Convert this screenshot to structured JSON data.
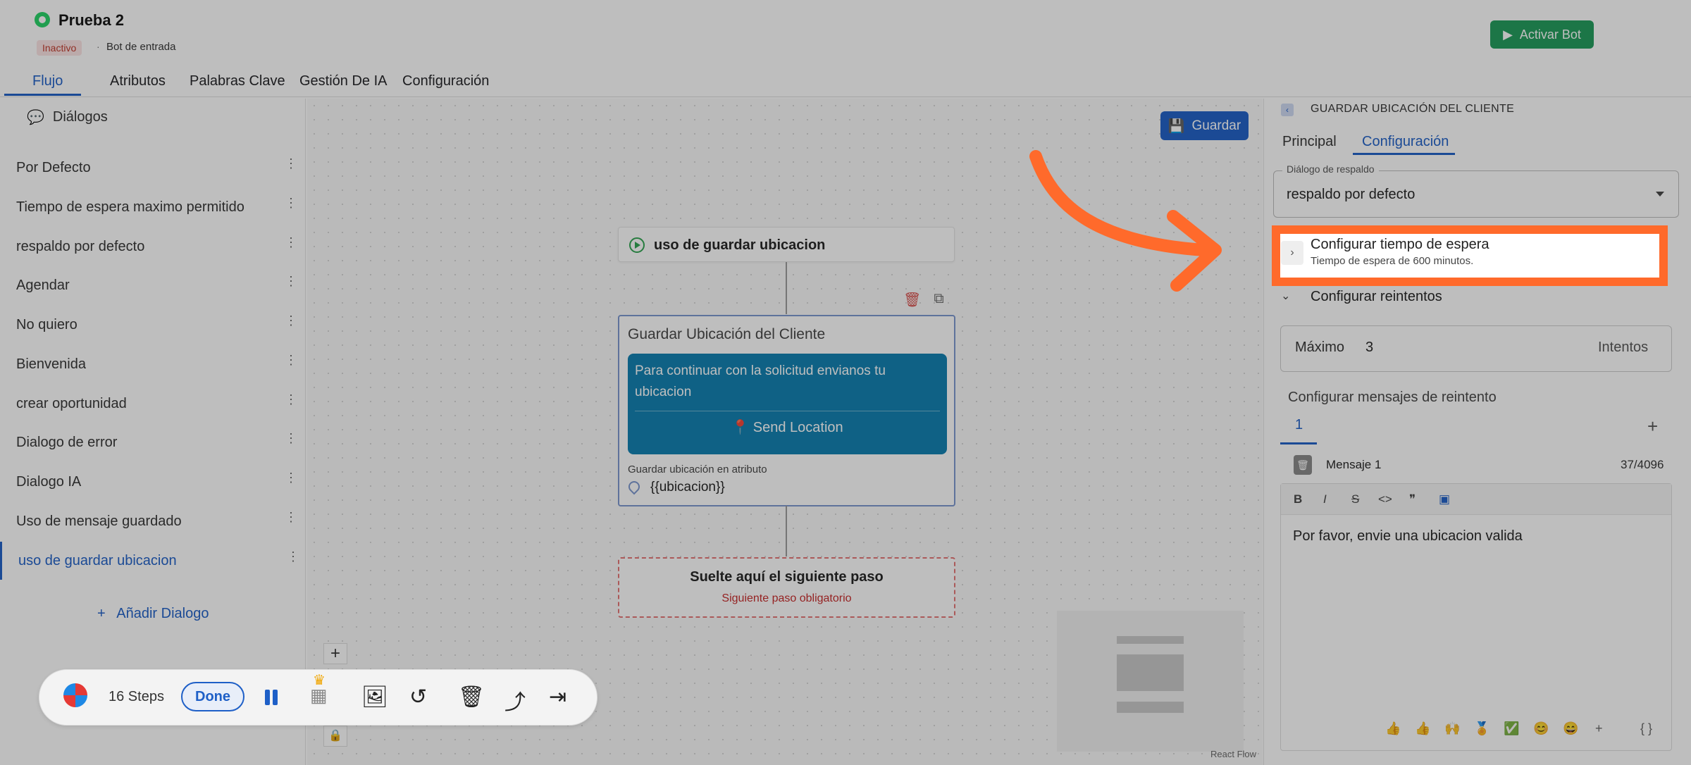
{
  "header": {
    "title": "Prueba 2",
    "status_badge": "Inactivo",
    "separator": "·",
    "bot_type": "Bot de entrada",
    "activate_button": "Activar Bot",
    "brand_color": "#25d366"
  },
  "tabs": [
    "Flujo",
    "Atributos",
    "Palabras Clave",
    "Gestión De IA",
    "Configuración"
  ],
  "sidebar": {
    "heading": "Diálogos",
    "items": [
      "Por Defecto",
      "Tiempo de espera maximo permitido",
      "respaldo por defecto",
      "Agendar",
      "No quiero",
      "Bienvenida",
      "crear oportunidad",
      "Dialogo de error",
      "Dialogo IA",
      "Uso de mensaje guardado",
      "uso de guardar ubicacion"
    ],
    "active_item": "uso de guardar ubicacion",
    "add_label": "Añadir Dialogo"
  },
  "canvas": {
    "save_button": "Guardar",
    "start_node": "uso de guardar ubicacion",
    "main_node": {
      "title": "Guardar Ubicación del Cliente",
      "message": "Para continuar con la solicitud envianos tu ubicacion",
      "button": "Send Location",
      "attr_label": "Guardar ubicación en atributo",
      "attr_value": "{{ubicacion}}"
    },
    "drop_node": {
      "title": "Suelte aquí el siguiente paso",
      "subtitle": "Siguiente paso obligatorio"
    },
    "zoom_in": "+",
    "attribution": "React Flow"
  },
  "panel": {
    "back_icon": "back-icon",
    "title": "GUARDAR UBICACIÓN DEL CLIENTE",
    "tabs": [
      "Principal",
      "Configuración"
    ],
    "fallback_legend": "Diálogo de respaldo",
    "fallback_value": "respaldo por defecto",
    "timeout_title": "Configurar tiempo de espera",
    "timeout_subtitle": "Tiempo de espera de 600 minutos.",
    "retries_title": "Configurar reintentos",
    "max_label": "Máximo",
    "max_value": "3",
    "max_unit": "Intentos",
    "retry_msgs_title": "Configurar mensajes de reintento",
    "msg_tab": "1",
    "add_msg": "+",
    "message_label": "Mensaje 1",
    "message_count": "37/4096",
    "toolbar": [
      "B",
      "I",
      "S",
      "<>",
      "❞",
      "▣"
    ],
    "message_text": "Por favor, envie una ubicacion valida",
    "emojis": [
      "👍",
      "👍",
      "🙌",
      "🏅",
      "✅",
      "😊",
      "😄",
      "+",
      "{ }"
    ]
  },
  "recorder": {
    "steps": "16 Steps",
    "done": "Done"
  },
  "colors": {
    "accent": "#1e5fc7",
    "highlight": "#ff6a2b",
    "message_bg": "#0d7fb0",
    "activate_bg": "#1f9c5a"
  }
}
